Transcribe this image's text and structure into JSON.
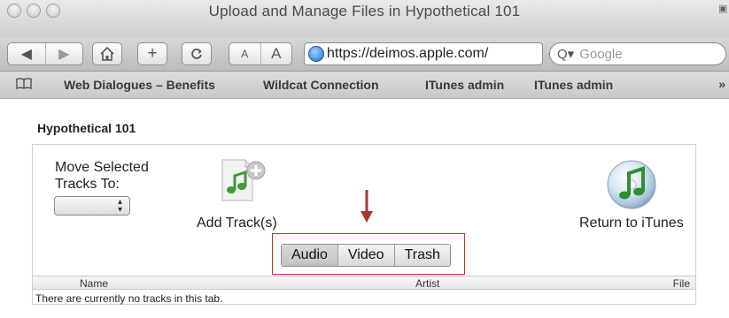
{
  "window": {
    "title": "Upload and Manage Files in Hypothetical 101"
  },
  "toolbar": {
    "back_icon": "back-arrow-icon",
    "forward_icon": "forward-arrow-icon",
    "home_icon": "home-icon",
    "add_icon": "plus-icon",
    "reload_icon": "reload-icon",
    "font_small": "A",
    "font_large": "A",
    "url": "https://deimos.apple.com/",
    "search_placeholder": "Google"
  },
  "bookmarks": {
    "items": [
      "Web Dialogues – Benefits",
      "Wildcat Connection",
      "ITunes admin",
      "ITunes admin"
    ],
    "more": "»"
  },
  "page": {
    "heading": "Hypothetical 101",
    "move_label": "Move Selected\nTracks To:",
    "add_tracks_label": "Add Track(s)",
    "return_label": "Return to iTunes",
    "tabs": [
      "Audio",
      "Video",
      "Trash"
    ],
    "selected_tab": "Audio",
    "columns": {
      "name": "Name",
      "artist": "Artist",
      "file": "File"
    },
    "empty_message": "There are currently no tracks in this tab.",
    "highlight_color": "#b8342a"
  }
}
